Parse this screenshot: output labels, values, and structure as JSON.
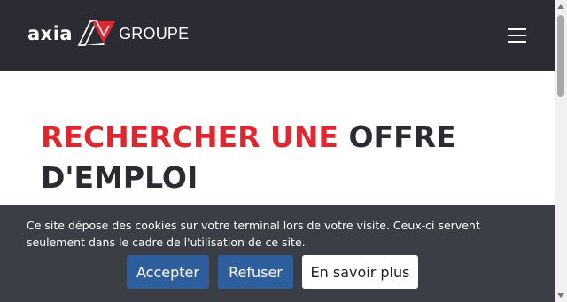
{
  "header": {
    "logo": {
      "brand": "axia",
      "suffix": "GROUPE",
      "mark_color": "#e0262f"
    },
    "menu_icon": "hamburger-menu-icon",
    "background": "#2b2b33"
  },
  "main": {
    "title_accent": "RECHERCHER UNE",
    "title_rest": "OFFRE D'EMPLOI",
    "accent_color": "#e0262f",
    "text_color": "#2b2b33"
  },
  "cookie_banner": {
    "message": "Ce site dépose des cookies sur votre terminal lors de votre visite. Ceux-ci servent seulement dans le cadre de l'utilisation de ce site.",
    "accept_label": "Accepter",
    "refuse_label": "Refuser",
    "more_label": "En savoir plus",
    "background": "#3c3e45",
    "button_color": "#2f5e9e"
  }
}
